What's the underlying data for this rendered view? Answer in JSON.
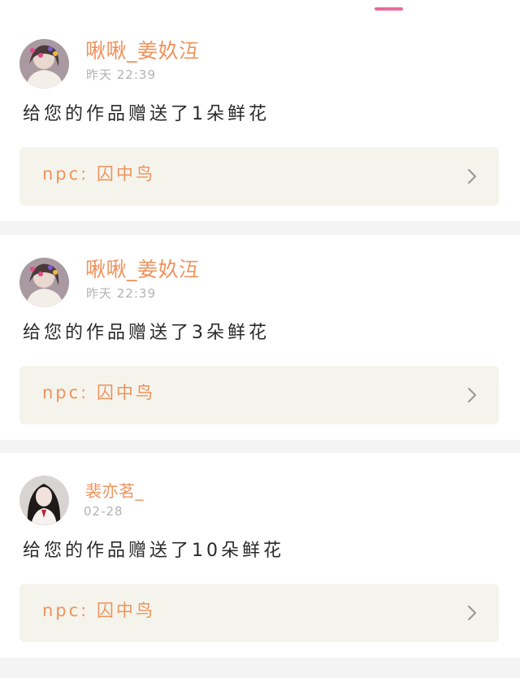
{
  "colors": {
    "accent_orange": "#f0925c",
    "indicator_pink": "#e86a9c",
    "card_link_bg": "#f4f4ec",
    "page_bg": "#f4f4f4"
  },
  "notifications": [
    {
      "avatar_icon": "user-avatar",
      "username": "啾啾_姜奺沍",
      "timestamp": "昨天 22:39",
      "message": "给您的作品赠送了1朵鲜花",
      "work_label": "npc: 囚中鸟",
      "chevron_icon": "chevron-right-icon"
    },
    {
      "avatar_icon": "user-avatar",
      "username": "啾啾_姜奺沍",
      "timestamp": "昨天 22:39",
      "message": "给您的作品赠送了3朵鲜花",
      "work_label": "npc: 囚中鸟",
      "chevron_icon": "chevron-right-icon"
    },
    {
      "avatar_icon": "user-avatar",
      "username": "裴亦茗_",
      "timestamp": "02-28",
      "message": "给您的作品赠送了10朵鲜花",
      "work_label": "npc: 囚中鸟",
      "chevron_icon": "chevron-right-icon"
    }
  ]
}
